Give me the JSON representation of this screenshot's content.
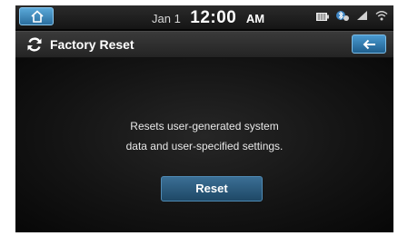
{
  "status_bar": {
    "home_icon": "home-icon",
    "date": "Jan 1",
    "time": "12:00",
    "ampm": "AM",
    "icons": [
      "battery-icon",
      "bluetooth-icon",
      "signal-icon",
      "wifi-icon"
    ]
  },
  "header": {
    "icon": "refresh-icon",
    "title": "Factory Reset",
    "back_icon": "back-arrow-icon"
  },
  "main": {
    "message_line1": "Resets user-generated system",
    "message_line2": "data and user-specified settings.",
    "reset_label": "Reset"
  },
  "colors": {
    "accent": "#2a6e9e",
    "background": "#050505",
    "text": "#ffffff"
  }
}
